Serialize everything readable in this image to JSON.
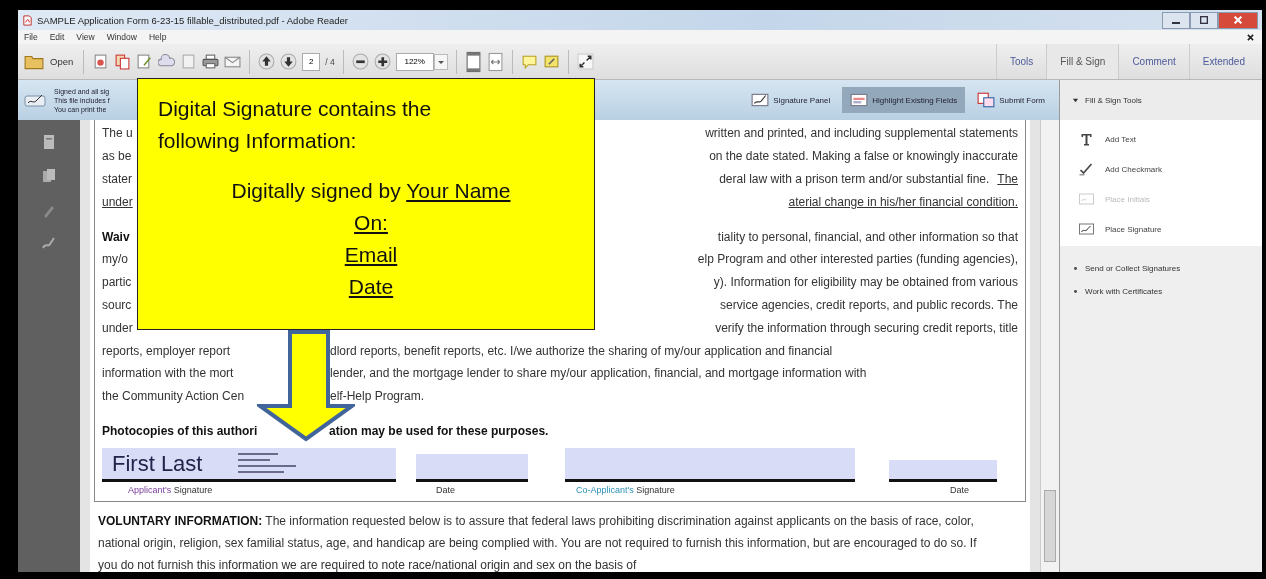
{
  "window": {
    "title": "SAMPLE Application Form 6-23-15 fillable_distributed.pdf - Adobe Reader"
  },
  "menu": [
    "File",
    "Edit",
    "View",
    "Window",
    "Help"
  ],
  "toolbar": {
    "open": "Open",
    "page": "2",
    "page_count": "/ 4",
    "zoom": "122%"
  },
  "tabs": [
    {
      "label": "Tools",
      "selected": false
    },
    {
      "label": "Fill & Sign",
      "selected": true
    },
    {
      "label": "Comment",
      "selected": false
    },
    {
      "label": "Extended",
      "selected": false
    }
  ],
  "info_bar": {
    "lines": [
      "Signed and all sig",
      "This file includes f",
      "You can print the"
    ],
    "buttons": [
      {
        "label": "Signature Panel",
        "selected": false,
        "kind": "signature"
      },
      {
        "label": "Highlight Existing Fields",
        "selected": true,
        "kind": "highlight"
      },
      {
        "label": "Submit Form",
        "selected": false,
        "kind": "submit"
      }
    ]
  },
  "side_panel": {
    "title": "Fill & Sign Tools",
    "expanded": true,
    "tools": [
      {
        "label": "Add Text",
        "disabled": false,
        "kind": "text"
      },
      {
        "label": "Add Checkmark",
        "disabled": false,
        "kind": "checkmark"
      },
      {
        "label": "Place Initials",
        "disabled": true,
        "kind": "initials"
      },
      {
        "label": "Place Signature",
        "disabled": false,
        "kind": "signature"
      }
    ],
    "sections": [
      {
        "label": "Send or Collect Signatures",
        "expanded": false
      },
      {
        "label": "Work with Certificates",
        "expanded": false
      }
    ]
  },
  "document": {
    "paragraphs": [
      [
        {
          "left": "The u",
          "right": [
            "written and printed, and including supplemental statements"
          ]
        },
        {
          "left": "as be",
          "right": [
            "on the date stated.  Making a false or knowingly inaccurate"
          ]
        },
        {
          "left": "stater",
          "right": [
            "deral law with a prison term and/or substantial fine.",
            "The"
          ]
        },
        {
          "left": "under",
          "right": [
            "aterial change in his/her financial condition."
          ]
        }
      ],
      [
        {
          "left": "Waiv",
          "right": [
            "tiality to personal, financial, and other information so that"
          ]
        },
        {
          "left": "my/o",
          "right": [
            "elp Program and other interested parties (funding agencies),"
          ]
        },
        {
          "left": "partic",
          "right": [
            "y).  Information for eligibility may be obtained from various"
          ]
        },
        {
          "left": "sourc",
          "right": [
            "service agencies, credit reports, and public records.  The"
          ]
        },
        {
          "left": "under",
          "right": [
            "verify the information through securing credit reports, title"
          ]
        },
        {
          "left": "reports, employer report",
          "right": [
            "dlord reports, benefit reports, etc.  I/we authorize the sharing of my/our application and financial"
          ]
        },
        {
          "left": "information with the mort",
          "right": [
            "lender, and the mortgage lender to share my/our application, financial, and mortgage information with"
          ]
        },
        {
          "left": "the Community Action Cen",
          "right": [
            "elf-Help Program."
          ]
        }
      ]
    ],
    "photocopies": {
      "left": "Photocopies of this authori",
      "right": "ation may be used for these purposes."
    },
    "signature": {
      "name": "First Last"
    },
    "signature_labels": [
      {
        "highlight": "Applicant's",
        "text": " Signature"
      },
      {
        "text": "Date"
      },
      {
        "highlight": "Co-Applicant's",
        "text": " Signature"
      },
      {
        "text": "Date"
      }
    ],
    "voluntary": "**VOLUNTARY INFORMATION:**  The information requested below is to assure that federal laws prohibiting discrimination against applicants on the basis of race, color, national origin, religion, sex familial status, age, and handicap are being complied with.  You are not required to furnish this information, but are encouraged to do so.  If you do not furnish this information we are required to note race/national origin and sex on the basis of"
  },
  "callout": {
    "heading": "Digital Signature contains the following Information:",
    "details": [
      {
        "label": "Digitally signed by ",
        "value": "Your Name"
      },
      {
        "value": "On:"
      },
      {
        "value": "Email"
      },
      {
        "value": "Date"
      }
    ]
  }
}
